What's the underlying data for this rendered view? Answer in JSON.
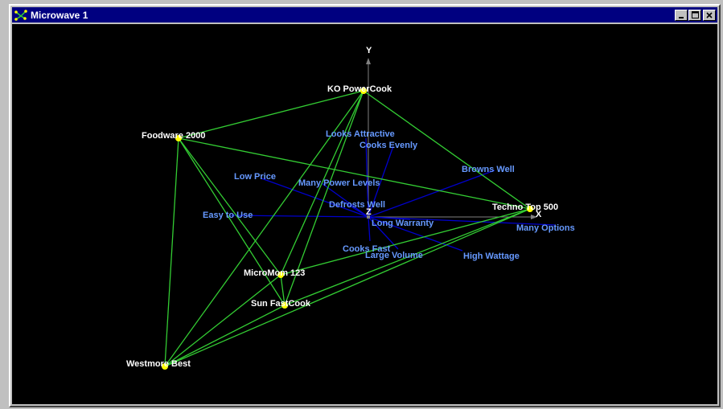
{
  "window": {
    "title": "Microwave 1",
    "controls": [
      "minimize",
      "maximize",
      "close"
    ]
  },
  "axes": {
    "x_label": "X",
    "y_label": "Y",
    "z_label": "Z"
  },
  "products": [
    {
      "id": "ko",
      "label": "KO PowerCook"
    },
    {
      "id": "foodware",
      "label": "Foodware 2000"
    },
    {
      "id": "techno",
      "label": "Techno Top 500"
    },
    {
      "id": "micromom",
      "label": "MicroMom 123"
    },
    {
      "id": "sunfast",
      "label": "Sun FastCook"
    },
    {
      "id": "westmore",
      "label": "Westmore Best"
    }
  ],
  "attributes": [
    "Looks Attractive",
    "Cooks Evenly",
    "Browns Well",
    "Low Price",
    "Many Power Levels",
    "Defrosts Well",
    "Easy to Use",
    "Long Warranty",
    "Many Options",
    "Cooks Fast",
    "Large Volume",
    "High Wattage"
  ],
  "colors": {
    "background": "#000000",
    "product_point": "#ffff00",
    "product_label": "#ffffff",
    "connection_line": "#33cc33",
    "attribute_vector": "#0000cc",
    "attribute_label": "#6699ff",
    "axis": "#808080",
    "titlebar": "#000080"
  }
}
